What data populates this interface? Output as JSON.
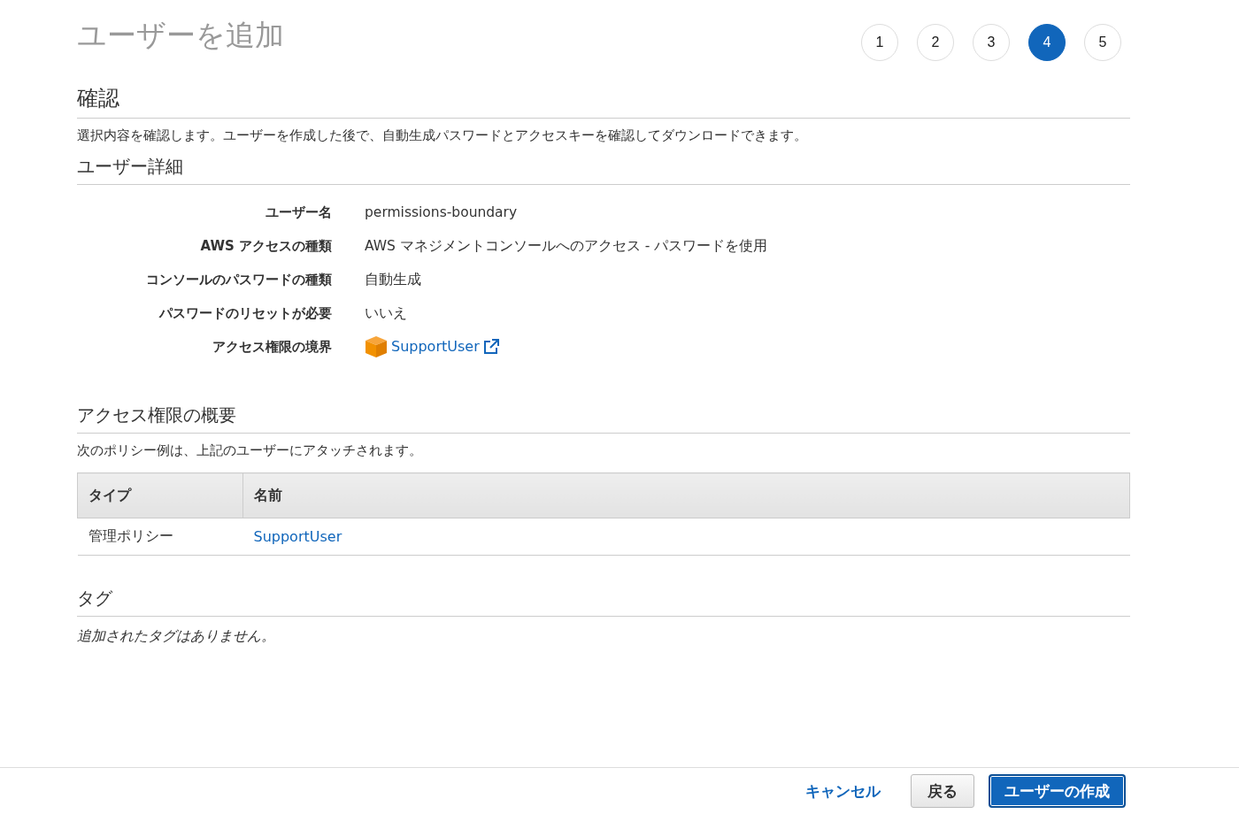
{
  "page_title": "ユーザーを追加",
  "steps": [
    {
      "label": "1",
      "selected": false
    },
    {
      "label": "2",
      "selected": false
    },
    {
      "label": "3",
      "selected": false
    },
    {
      "label": "4",
      "selected": true
    },
    {
      "label": "5",
      "selected": false
    }
  ],
  "review": {
    "heading": "確認",
    "description": "選択内容を確認します。ユーザーを作成した後で、自動生成パスワードとアクセスキーを確認してダウンロードできます。"
  },
  "user_details": {
    "heading": "ユーザー詳細",
    "rows": [
      {
        "label": "ユーザー名",
        "value": "permissions-boundary",
        "kind": "text"
      },
      {
        "label": "AWS アクセスの種類",
        "value": "AWS マネジメントコンソールへのアクセス - パスワードを使用",
        "kind": "text"
      },
      {
        "label": "コンソールのパスワードの種類",
        "value": "自動生成",
        "kind": "text"
      },
      {
        "label": "パスワードのリセットが必要",
        "value": "いいえ",
        "kind": "text"
      },
      {
        "label": "アクセス権限の境界",
        "value": "SupportUser",
        "kind": "policy-link"
      }
    ]
  },
  "permissions_summary": {
    "heading": "アクセス権限の概要",
    "description": "次のポリシー例は、上記のユーザーにアタッチされます。",
    "table": {
      "columns": [
        "タイプ",
        "名前"
      ],
      "rows": [
        [
          "管理ポリシー",
          "SupportUser"
        ]
      ]
    }
  },
  "tags": {
    "heading": "タグ",
    "empty_message": "追加されたタグはありません。"
  },
  "footer": {
    "cancel": "キャンセル",
    "back": "戻る",
    "create": "ユーザーの作成"
  }
}
